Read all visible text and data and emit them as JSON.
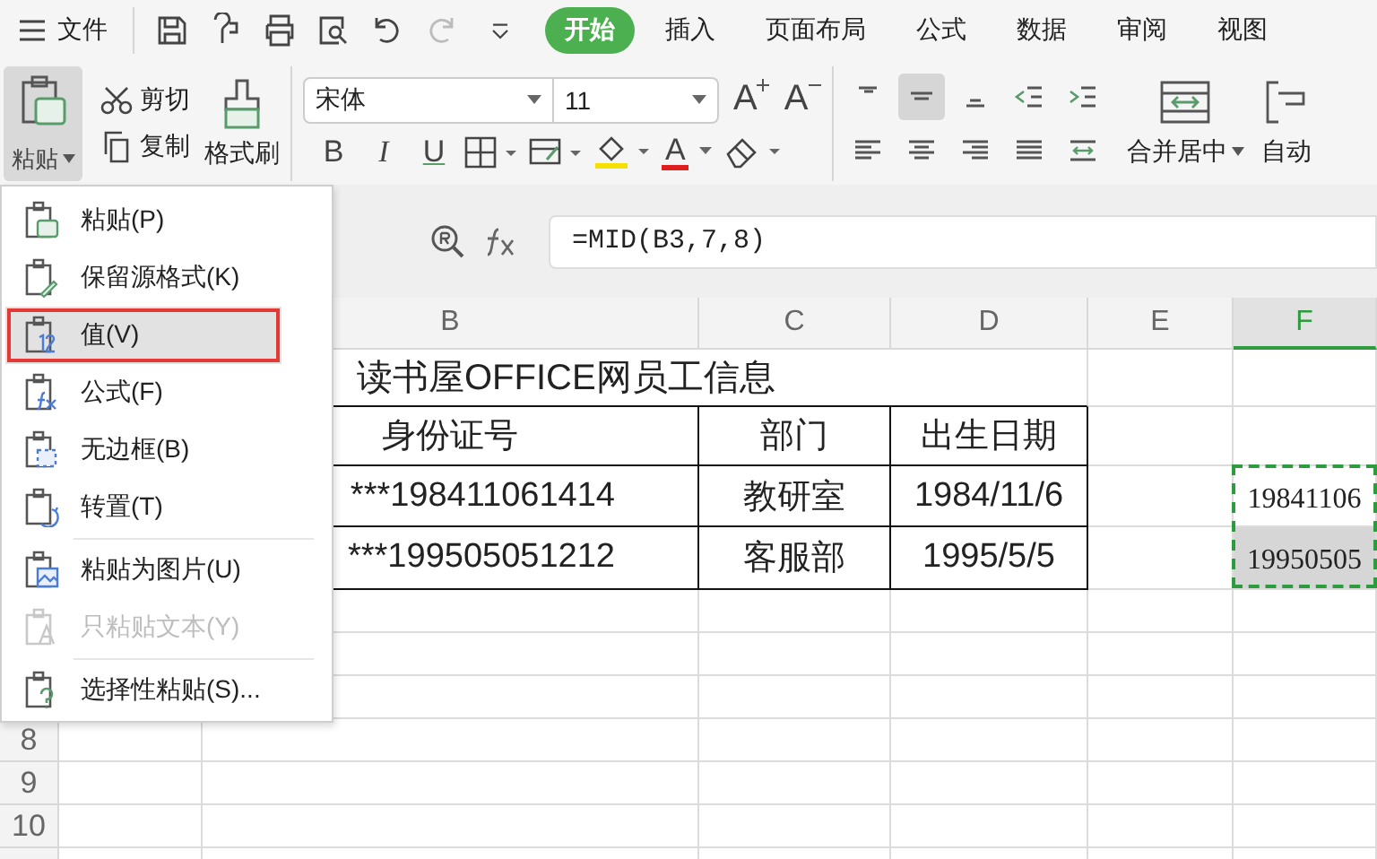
{
  "menu_bar": {
    "menu_label": "文件",
    "quick_access": [
      {
        "kind": "save",
        "disabled": false
      },
      {
        "kind": "format",
        "disabled": false
      },
      {
        "kind": "print",
        "disabled": false
      },
      {
        "kind": "preview",
        "disabled": false
      },
      {
        "kind": "undo",
        "disabled": false
      },
      {
        "kind": "redo",
        "disabled": true
      },
      {
        "kind": "customize",
        "disabled": false
      }
    ],
    "tabs": [
      {
        "label": "开始",
        "selected": true
      },
      {
        "label": "插入",
        "selected": false
      },
      {
        "label": "页面布局",
        "selected": false
      },
      {
        "label": "公式",
        "selected": false
      },
      {
        "label": "数据",
        "selected": false
      },
      {
        "label": "审阅",
        "selected": false
      },
      {
        "label": "视图",
        "selected": false
      }
    ]
  },
  "ribbon": {
    "paste": {
      "label": "粘贴",
      "expanded": true
    },
    "cut": "剪切",
    "copy": "复制",
    "format_painter": "格式刷",
    "font": {
      "family": "宋体",
      "size": "11"
    },
    "grow_font": "A",
    "shrink_font": "A",
    "font_styles": [
      "B",
      "I",
      "U"
    ],
    "font_color": "A",
    "alignment": [
      {
        "kind": "top",
        "selected": false
      },
      {
        "kind": "middle",
        "selected": true
      },
      {
        "kind": "bottom",
        "selected": false
      },
      {
        "kind": "outdent",
        "selected": false
      },
      {
        "kind": "indent",
        "selected": false
      },
      {
        "kind": "left",
        "selected": false
      },
      {
        "kind": "center",
        "selected": false
      },
      {
        "kind": "right",
        "selected": false
      },
      {
        "kind": "justify",
        "selected": false
      },
      {
        "kind": "distributed",
        "selected": false
      }
    ],
    "merge": "合并居中",
    "wrap": "自动"
  },
  "formula_bar": {
    "formula": "=MID(B3,7,8)"
  },
  "sheet": {
    "columns": [
      {
        "label": "B",
        "selected": false
      },
      {
        "label": "C",
        "selected": false
      },
      {
        "label": "D",
        "selected": false
      },
      {
        "label": "E",
        "selected": false
      },
      {
        "label": "F",
        "selected": true
      }
    ],
    "title": "读书屋OFFICE网员工信息",
    "table_header": [
      "身份证号",
      "部门",
      "出生日期"
    ],
    "records": [
      {
        "id": "***198411061414",
        "department": "教研室",
        "birth_date": "1984/11/6",
        "extracted": "19841106",
        "selected": false
      },
      {
        "id": "***199505051212",
        "department": "客服部",
        "birth_date": "1995/5/5",
        "extracted": "19950505",
        "selected": true
      }
    ],
    "copy_range_marked": true,
    "row_numbers": [
      "8",
      "9",
      "10"
    ]
  },
  "paste_menu": {
    "items": [
      {
        "kind": "paste",
        "label": "粘贴(P)",
        "selected": false,
        "disabled": false
      },
      {
        "kind": "keep-format",
        "label": "保留源格式(K)",
        "selected": false,
        "disabled": false
      },
      {
        "kind": "values",
        "label": "值(V)",
        "selected": true,
        "disabled": false
      },
      {
        "kind": "formulas",
        "label": "公式(F)",
        "selected": false,
        "disabled": false
      },
      {
        "kind": "no-borders",
        "label": "无边框(B)",
        "selected": false,
        "disabled": false
      },
      {
        "kind": "transpose",
        "label": "转置(T)",
        "selected": false,
        "disabled": false
      },
      {
        "kind": "separator"
      },
      {
        "kind": "picture",
        "label": "粘贴为图片(U)",
        "selected": false,
        "disabled": false
      },
      {
        "kind": "text",
        "label": "只粘贴文本(Y)",
        "selected": false,
        "disabled": true
      },
      {
        "kind": "separator"
      },
      {
        "kind": "special",
        "label": "选择性粘贴(S)...",
        "selected": false,
        "disabled": false
      }
    ]
  }
}
